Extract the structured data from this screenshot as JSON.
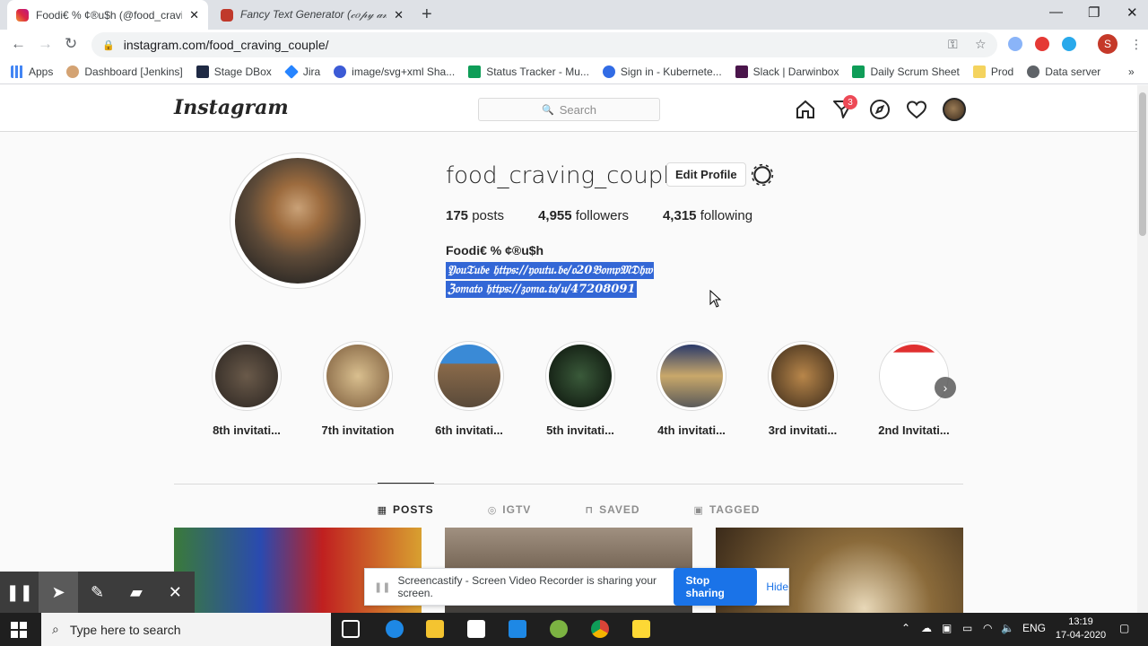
{
  "browser": {
    "tabs": [
      {
        "title": "Foodi€ % ¢®u$h (@food_craving_couple)",
        "favicon_color": "#d6249f"
      },
      {
        "title": "Fancy Text Generator (𝒸𝑜𝓅𝓎 𝒶𝓃𝒹 𝓅𝒶𝓈𝓉𝑒)",
        "favicon_color": "#c0392b"
      }
    ],
    "new_tab": "+",
    "close_glyph": "✕",
    "window_controls": [
      "—",
      "❐",
      "✕"
    ],
    "url": "instagram.com/food_craving_couple/",
    "profile_initial": "S",
    "bookmarks": [
      {
        "label": "Apps",
        "color": "#4285f4"
      },
      {
        "label": "Dashboard [Jenkins]",
        "color": "#d4a373"
      },
      {
        "label": "Stage DBox",
        "color": "#1f2a44"
      },
      {
        "label": "Jira",
        "color": "#2684ff"
      },
      {
        "label": "image/svg+xml Sha...",
        "color": "#3c5bd6"
      },
      {
        "label": "Status Tracker - Mu...",
        "color": "#0f9d58"
      },
      {
        "label": "Sign in - Kubernete...",
        "color": "#326ce5"
      },
      {
        "label": "Slack | Darwinbox",
        "color": "#4a154b"
      },
      {
        "label": "Daily Scrum Sheet",
        "color": "#0f9d58"
      },
      {
        "label": "Prod",
        "color": "#f4d35e"
      },
      {
        "label": "Data server",
        "color": "#5f6368"
      }
    ],
    "more": "»"
  },
  "instagram": {
    "logo": "Instagram",
    "search_placeholder": "Search",
    "notification_count": "3",
    "profile": {
      "username": "food_craving_couple",
      "edit_profile": "Edit Profile",
      "posts_count": "175",
      "posts_label": "posts",
      "followers_count": "4,955",
      "followers_label": "followers",
      "following_count": "4,315",
      "following_label": "following",
      "full_name": "Foodi€ % ¢®u$h",
      "bio_line1": "𝔜𝔬𝔲𝔗𝔲𝔟𝔢 𝔥𝔱𝔱𝔭𝔰://𝔶𝔬𝔲𝔱𝔲.𝔟𝔢/𝔬20𝔅𝔬𝔪𝔭𝔐𝔇𝔥𝔴",
      "bio_line2": "ℨ𝔬𝔪𝔞𝔱𝔬 𝔥𝔱𝔱𝔭𝔰://𝔷𝔬𝔪𝔞.𝔱𝔬/𝔲/47208091"
    },
    "highlights": [
      {
        "label": "8th invitati...",
        "color": "#3a2f2a"
      },
      {
        "label": "7th invitation",
        "color": "#b38f5f"
      },
      {
        "label": "6th invitati...",
        "color": "#7a6a5a"
      },
      {
        "label": "5th invitati...",
        "color": "#1e2a20"
      },
      {
        "label": "4th invitati...",
        "color": "#6a7a8a"
      },
      {
        "label": "3rd invitati...",
        "color": "#5a4a30"
      },
      {
        "label": "2nd Invitati...",
        "color": "#e8e8e8"
      }
    ],
    "highlight_next": "›",
    "tabs": [
      {
        "label": "POSTS",
        "icon": "▦"
      },
      {
        "label": "IGTV",
        "icon": "◎"
      },
      {
        "label": "SAVED",
        "icon": "⊓"
      },
      {
        "label": "TAGGED",
        "icon": "▣"
      }
    ],
    "posts": [
      {
        "color": "#4a6a3a"
      },
      {
        "color": "#8a7a6a"
      },
      {
        "color": "#6a5a3a"
      }
    ]
  },
  "screencastify": {
    "tools": [
      "❚❚",
      "➤",
      "✎",
      "▰",
      "✕"
    ],
    "pause_glyph": "❚❚",
    "message": "Screencastify - Screen Video Recorder is sharing your screen.",
    "stop_label": "Stop sharing",
    "hide_label": "Hide"
  },
  "taskbar": {
    "search_placeholder": "Type here to search",
    "language": "ENG",
    "time": "13:19",
    "date": "17-04-2020"
  }
}
